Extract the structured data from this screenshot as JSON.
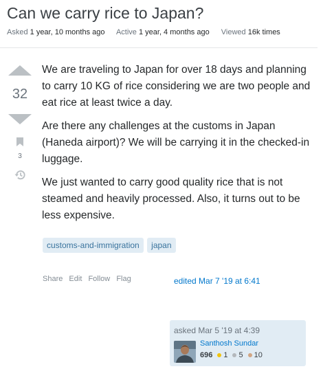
{
  "question": {
    "title": "Can we carry rice to Japan?",
    "meta": {
      "asked_label": "Asked",
      "asked_value": "1 year, 10 months ago",
      "active_label": "Active",
      "active_value": "1 year, 4 months ago",
      "viewed_label": "Viewed",
      "viewed_value": "16k times"
    },
    "votes": "32",
    "bookmarks": "3",
    "body": [
      "We are traveling to Japan for over 18 days and planning to carry 10 KG of rice considering we are two people and eat rice at least twice a day.",
      "Are there any challenges at the customs in Japan (Haneda airport)? We will be carrying it in the checked-in luggage.",
      "We just wanted to carry good quality rice that is not steamed and heavily processed. Also, it turns out to be less expensive."
    ],
    "tags": [
      "customs-and-immigration",
      "japan"
    ],
    "actions": {
      "share": "Share",
      "edit": "Edit",
      "follow": "Follow",
      "flag": "Flag"
    },
    "edited": "edited Mar 7 '19 at 6:41",
    "owner": {
      "asked": "asked Mar 5 '19 at 4:39",
      "name": "Santhosh Sundar",
      "reputation": "696",
      "gold": "1",
      "silver": "5",
      "bronze": "10"
    }
  },
  "colors": {
    "gold": "#f1c40f",
    "silver": "#b4b8bc",
    "bronze": "#d1a684",
    "link": "#0077cc",
    "tag_bg": "#e1ecf4",
    "tag_text": "#39739d"
  },
  "icons": [
    "upvote-icon",
    "downvote-icon",
    "bookmark-icon",
    "history-icon"
  ]
}
